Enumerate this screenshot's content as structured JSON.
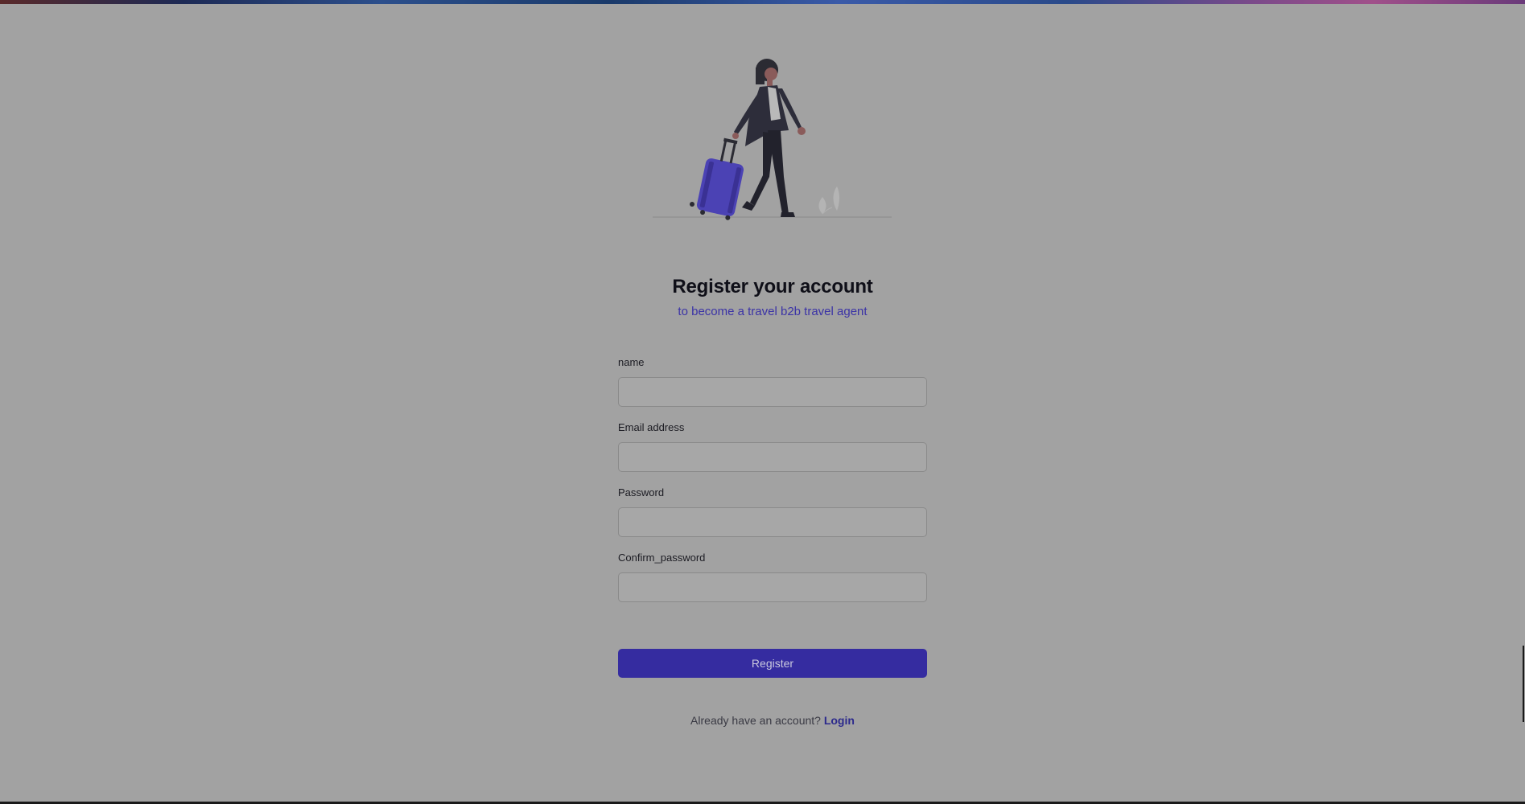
{
  "header": {
    "title": "Register your account",
    "subtitle": "to become a travel b2b travel agent"
  },
  "form": {
    "fields": [
      {
        "label": "name",
        "value": "",
        "placeholder": ""
      },
      {
        "label": "Email address",
        "value": "",
        "placeholder": ""
      },
      {
        "label": "Password",
        "value": "",
        "placeholder": ""
      },
      {
        "label": "Confirm_password",
        "value": "",
        "placeholder": ""
      }
    ],
    "submit_label": "Register"
  },
  "footer": {
    "prompt": "Already have an account?",
    "login_label": "Login"
  },
  "colors": {
    "accent": "#352ca0",
    "background": "#a2a2a2",
    "subtitle": "#3b33a6"
  },
  "icons": {
    "illustration": "traveler-with-suitcase-illustration"
  }
}
